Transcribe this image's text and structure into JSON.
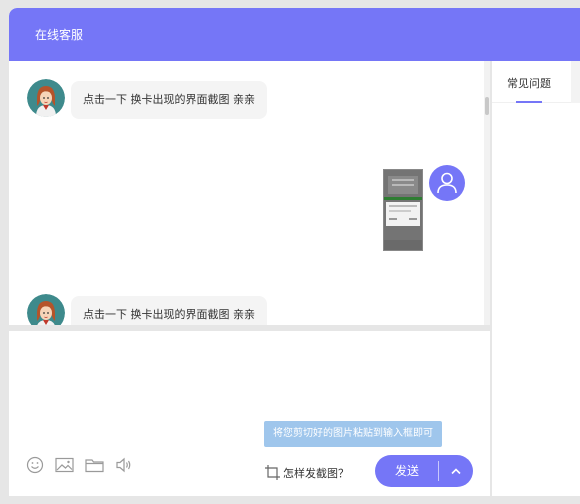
{
  "header": {
    "title": "在线客服"
  },
  "chat": {
    "messages": [
      {
        "sender": "agent",
        "text": "点击一下 换卡出现的界面截图 亲亲"
      },
      {
        "sender": "user",
        "type": "image"
      },
      {
        "sender": "agent",
        "text": "点击一下 换卡出现的界面截图 亲亲"
      }
    ]
  },
  "right_panel": {
    "tab_faq": "常见问题"
  },
  "input": {
    "tooltip": "将您剪切好的图片粘贴到输入框即可",
    "screenshot_help": "怎样发截图？",
    "send_label": "发送"
  },
  "toolbar": {
    "icons": [
      "emoji-icon",
      "image-icon",
      "folder-icon",
      "voice-icon"
    ]
  },
  "colors": {
    "accent": "#7576f7",
    "tooltip": "#9fc6ec",
    "background": "#e6e6e6"
  }
}
